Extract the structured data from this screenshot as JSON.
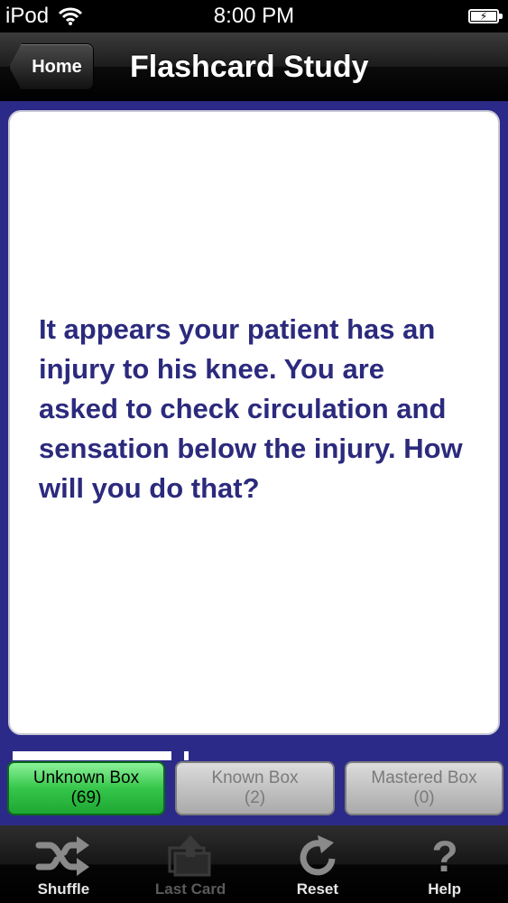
{
  "status_bar": {
    "carrier": "iPod",
    "time": "8:00 PM"
  },
  "nav": {
    "back_label": "Home",
    "title": "Flashcard Study"
  },
  "card": {
    "text": "It appears your patient has an injury to his knee. You are asked to check circulation and sensation below the injury. How will you do that?"
  },
  "progress": {
    "fill_fraction": 0.88
  },
  "boxes": [
    {
      "label": "Unknown Box",
      "count": "(69)",
      "state": "selected"
    },
    {
      "label": "Known Box",
      "count": "(2)",
      "state": "inactive"
    },
    {
      "label": "Mastered Box",
      "count": "(0)",
      "state": "inactive"
    }
  ],
  "tabs": [
    {
      "label": "Shuffle",
      "icon": "shuffle-icon",
      "enabled": true
    },
    {
      "label": "Last Card",
      "icon": "last-card-icon",
      "enabled": false
    },
    {
      "label": "Reset",
      "icon": "reset-icon",
      "enabled": true
    },
    {
      "label": "Help",
      "icon": "help-icon",
      "enabled": true
    }
  ],
  "colors": {
    "background": "#2b2a88",
    "card_text": "#2b2a7d",
    "selected_box": "#35c64a"
  }
}
